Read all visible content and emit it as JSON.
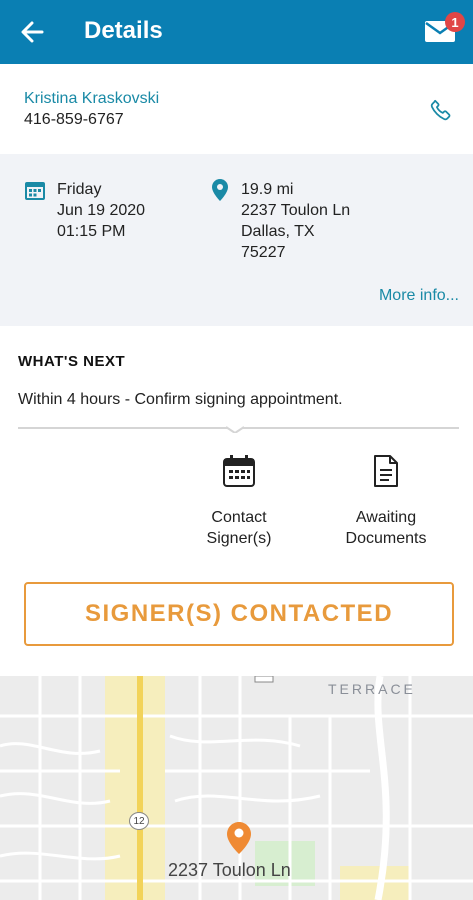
{
  "header": {
    "title": "Details",
    "back_icon": "arrow-left-icon",
    "mail_icon": "envelope-icon",
    "notification_count": "1",
    "colors": {
      "bar": "#0a7fb3",
      "badge": "#e04646"
    }
  },
  "contact": {
    "name": "Kristina Kraskovski",
    "phone": "416-859-6767",
    "call_icon": "phone-icon"
  },
  "appointment": {
    "day": "Friday",
    "date": "Jun 19 2020",
    "time": "01:15 PM",
    "distance": "19.9 mi",
    "street": "2237 Toulon Ln",
    "city": "Dallas, TX",
    "zip": "75227",
    "more_info": "More info..."
  },
  "whats_next": {
    "heading": "WHAT'S NEXT",
    "description": "Within 4 hours - Confirm signing appointment.",
    "steps": [
      {
        "line1": "Contact",
        "line2": "Signer(s)",
        "icon": "calendar-icon"
      },
      {
        "line1": "Awaiting",
        "line2": "Documents",
        "icon": "document-icon"
      }
    ],
    "action_label": "SIGNER(S) CONTACTED",
    "accent_color": "#e89a3c"
  },
  "map": {
    "label": "2237 Toulon Ln",
    "area_label": "TERRACE",
    "road_number": "12"
  }
}
